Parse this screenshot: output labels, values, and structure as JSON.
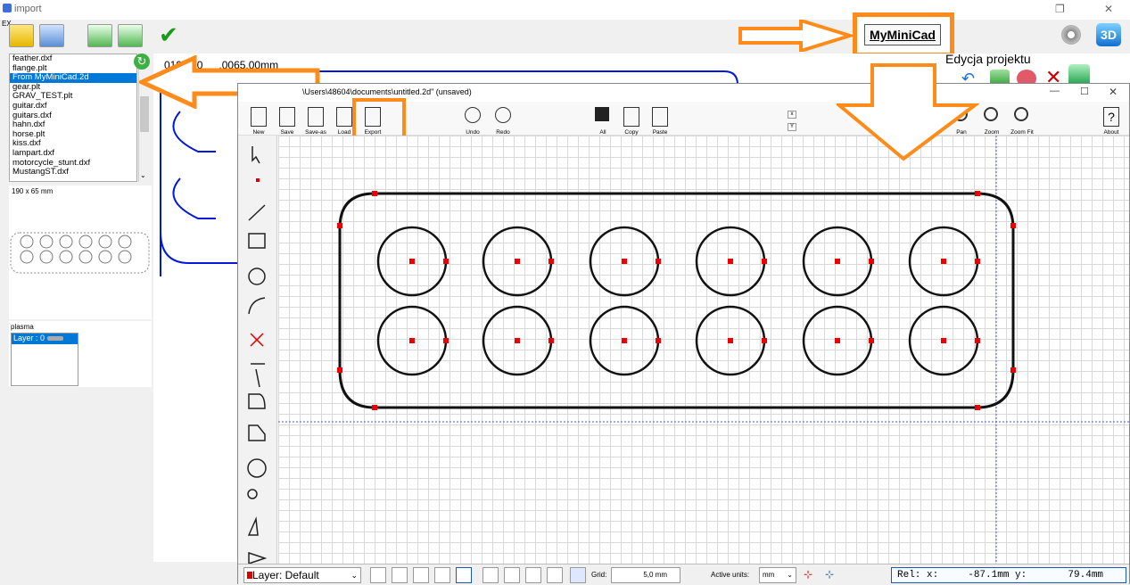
{
  "outer": {
    "title": "import",
    "ex_label": "EX",
    "files": [
      "feather.dxf",
      "flange.plt",
      "From MyMiniCad.2d",
      "gear.plt",
      "GRAV_TEST.plt",
      "guitar.dxf",
      "guitars.dxf",
      "hahn.dxf",
      "horse.plt",
      "kiss.dxf",
      "lampart.dxf",
      "motorcycle_stunt.dxf",
      "MustangST.dxf"
    ],
    "selected_file_index": 2,
    "coords_text": "0190.00",
    "coords_text2": ".0065.00mm",
    "size_text": "190 x 65 mm",
    "material_label": "plasma",
    "layer_item": "Layer : 0",
    "project_label": "Edycja projektu",
    "brand_label": "MyMiniCad"
  },
  "mm": {
    "title": "\\Users\\48604\\documents\\untitled.2d\" (unsaved)",
    "toolbar": {
      "new": "New",
      "save": "Save",
      "saveas": "Save-as",
      "load": "Load",
      "export": "Export",
      "undo": "Undo",
      "redo": "Redo",
      "all": "All",
      "copy": "Copy",
      "paste": "Paste",
      "pan": "Pan",
      "zoom": "Zoom",
      "zoomfit": "Zoom Fit",
      "about": "About"
    },
    "status": {
      "layer": "Layer: Default",
      "grid_label": "Grid:",
      "grid_value": "5,0 mm",
      "units_label": "Active units:",
      "units_value": "mm",
      "rel": "Rel: x:     -87.1mm y:       79.4mm"
    }
  },
  "accent": "#ff8c1a",
  "selection": "#0078d7"
}
